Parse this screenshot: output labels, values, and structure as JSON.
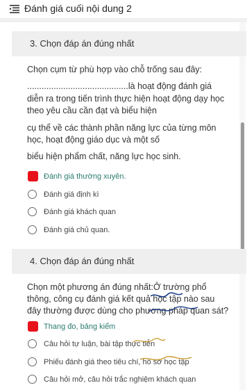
{
  "header": {
    "title": "Đánh giá cuối nội dung 2"
  },
  "questions": [
    {
      "heading": "3. Chọn đáp án đúng nhất",
      "prompt_lines": [
        "Chọn cụm từ phù hợp vào chỗ trống sau đây:",
        "..........................................là hoạt động đánh giá",
        "diễn ra trong tiến trình thực hiện hoạt động dạy học",
        "theo yêu cầu cần đạt và biểu hiện",
        "cụ thể về các thành phần năng lực của từng môn",
        "học, hoạt động giáo dục và một số",
        "biểu hiện phẩm chất, năng lực học sinh."
      ],
      "options": [
        {
          "label": "Đánh giá thường xuyên.",
          "selected": true
        },
        {
          "label": "Đánh giá định kì",
          "selected": false
        },
        {
          "label": "Đánh giá khách quan",
          "selected": false
        },
        {
          "label": "Đánh giá chủ quan.",
          "selected": false
        }
      ]
    },
    {
      "heading": "4. Chọn đáp án đúng nhất",
      "prompt_lines": [
        "Chọn một phương án đúng nhất:Ở trường phổ",
        "thông, công cụ đánh giá kết quả học tập nào sau",
        "đây thường được dùng cho phương pháp quan sát?"
      ],
      "options": [
        {
          "label": "Thang đo, bảng kiểm",
          "selected": true
        },
        {
          "label": "Câu hỏi tự luận, bài tập thực tiễn",
          "selected": false
        },
        {
          "label": "Phiếu đánh giá theo tiêu chí, hồ sơ học tập",
          "selected": false
        },
        {
          "label": "Câu hỏi mở, câu hỏi trắc nghiệm khách quan",
          "selected": false
        }
      ]
    }
  ],
  "colors": {
    "selected": "#e8121b",
    "selected_text": "#2a7a6f",
    "header_bg": "#efefef"
  }
}
